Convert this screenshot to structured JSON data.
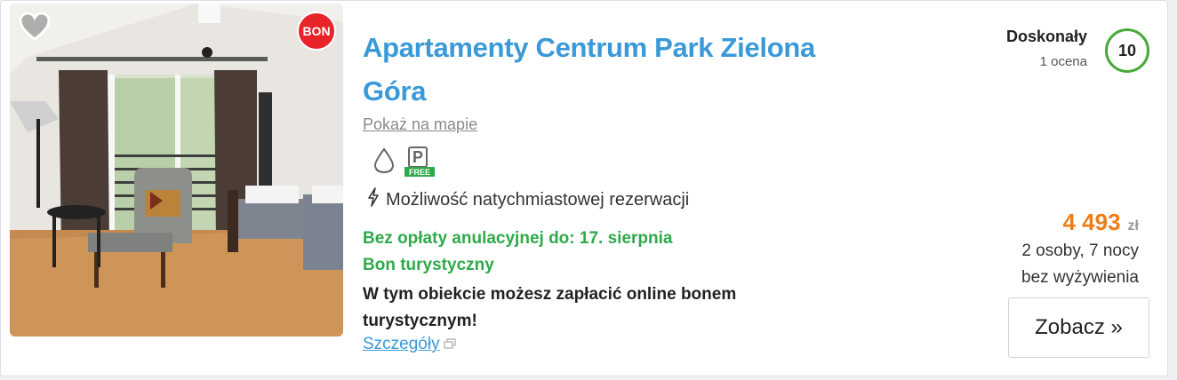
{
  "listing": {
    "title": "Apartamenty Centrum Park Zielona Góra",
    "map_link": "Pokaż na mapie",
    "badge": "BON",
    "amenities": [
      "water-drop-icon",
      "parking-free-icon"
    ],
    "parking_free_label": "FREE",
    "parking_letter": "P",
    "instant_booking": "Możliwość natychmiastowej rezerwacji",
    "free_cancel": "Bez opłaty anulacyjnej do: 17. sierpnia",
    "voucher_title": "Bon turystyczny",
    "voucher_desc": "W tym obiekcie możesz zapłacić online bonem turystycznym!",
    "details_link": "Szczegóły"
  },
  "rating": {
    "label": "Doskonały",
    "count": "1 ocena",
    "score": "10"
  },
  "pricing": {
    "price": "4 493",
    "currency": "zł",
    "guests": "2 osoby, 7 nocy",
    "board": "bez wyżywienia",
    "cta": "Zobacz »"
  },
  "colors": {
    "title": "#3a99d8",
    "price": "#f07d17",
    "green": "#2eaa4a",
    "badge": "#e8232a",
    "score_ring": "#48a83a"
  }
}
